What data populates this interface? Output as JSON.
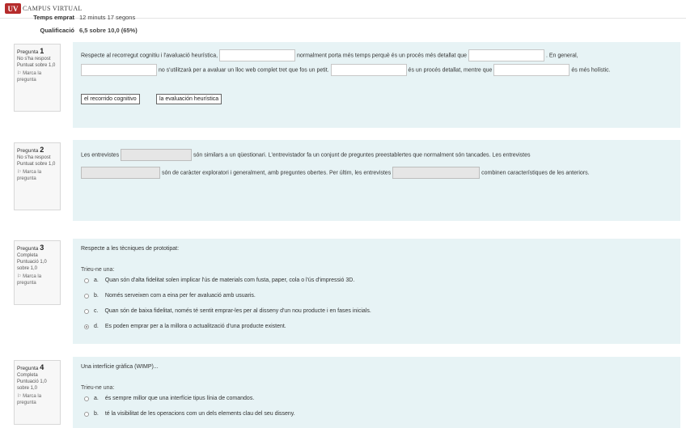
{
  "brand": {
    "mark": "UV",
    "name": "CAMPUS VIRTUAL"
  },
  "summary": {
    "time_label": "Temps emprat",
    "time_value": "12 minuts 17 segons",
    "grade_label": "Qualificació",
    "grade_value": "6,5 sobre 10,0 (65%)"
  },
  "questions": [
    {
      "number_prefix": "Pregunta",
      "number": "1",
      "status": "No s'ha respost",
      "score": "Puntuat sobre 1,0",
      "flag": "Marca la pregunta",
      "text1": "Respecte al recorregut cognitiu i l'avaluació heurística,",
      "text2": "normalment porta més temps perquè és un procés més detallat que",
      "text3": ". En general,",
      "text4": "no s'utilitzarà per a avaluar un lloc web complet tret que fos un petit.",
      "text5": "és un procés detallat, mentre que",
      "text6": "és més holístic.",
      "drag1": "el recorrido cognitivo",
      "drag2": "la evaluación heurística"
    },
    {
      "number_prefix": "Pregunta",
      "number": "2",
      "status": "No s'ha respost",
      "score": "Puntuat sobre 1,0",
      "flag": "Marca la pregunta",
      "text1": "Les entrevistes",
      "text2": "són similars a un qüestionari. L'entrevistador fa un conjunt de preguntes preestablertes que normalment són tancades. Les entrevistes",
      "text3": "són de caràcter exploratori i generalment, amb preguntes obertes. Per últim, les entrevistes",
      "text4": "combinen característiques de les anteriors."
    },
    {
      "number_prefix": "Pregunta",
      "number": "3",
      "status": "Completa",
      "score": "Puntuació 1,0 sobre 1,0",
      "flag": "Marca la pregunta",
      "text": "Respecte a les tècniques de prototipat:",
      "prompt": "Trieu-ne una:",
      "options": [
        {
          "letter": "a.",
          "text": "Quan són d'alta fidelitat solen implicar l'ús de materials com fusta, paper, cola o l'ús d'impressió 3D."
        },
        {
          "letter": "b.",
          "text": "Només serveixen com a eina per fer avaluació amb usuaris."
        },
        {
          "letter": "c.",
          "text": "Quan són de baixa fidelitat, només té sentit emprar-les per al disseny d'un nou producte i en fases inicials."
        },
        {
          "letter": "d.",
          "text": "Es poden emprar per a la millora o actualització d'una producte existent."
        }
      ]
    },
    {
      "number_prefix": "Pregunta",
      "number": "4",
      "status": "Completa",
      "score": "Puntuació 1,0 sobre 1,0",
      "flag": "Marca la pregunta",
      "text": "Una interfície gràfica (WIMP)...",
      "prompt": "Trieu-ne una:",
      "options": [
        {
          "letter": "a.",
          "text": "és sempre millor que una interfície tipus línia de comandos."
        },
        {
          "letter": "b.",
          "text": "té la visibilitat de les operacions com un dels elements clau del seu disseny."
        }
      ]
    }
  ]
}
